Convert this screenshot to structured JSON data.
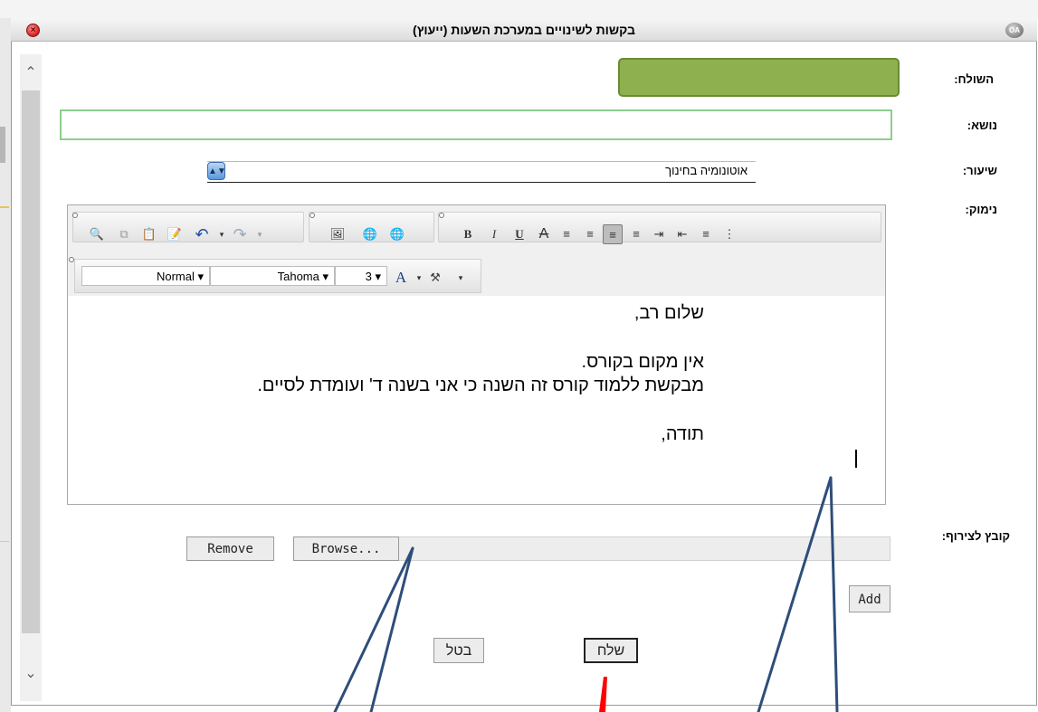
{
  "window": {
    "title": "בקשות לשינויים במערכת השעות (ייעוץ)"
  },
  "form": {
    "sender_label": "השולח:",
    "subject_label": "נושא:",
    "subject_value": "",
    "lesson_label": "שיעור:",
    "lesson_value": "אוטונומיה בחינוך",
    "reason_label": "נימוק:",
    "attach_label": "קובץ לצירוף:"
  },
  "editor": {
    "toolbar": {
      "format": "Normal",
      "font": "Tahoma",
      "size": "3",
      "font_color_glyph": "A"
    },
    "body_lines": [
      "שלום רב,",
      "",
      "אין מקום בקורס.",
      "מבקשת ללמוד קורס זה השנה כי אני בשנה ד' ועומדת לסיים.",
      "",
      "תודה,"
    ]
  },
  "buttons": {
    "remove": "Remove",
    "browse": "Browse...",
    "add": "Add",
    "cancel": "בטל",
    "send": "שלח"
  },
  "colors": {
    "sender_box": "#8fb04e",
    "subject_border": "#8cce8c",
    "annotation_lines": "#2e4e7a",
    "annotation_highlight": "#ff0000"
  },
  "icons": {
    "close": "close-icon",
    "app_logo": "app-logo-icon",
    "scroll_up": "chevron-up-icon",
    "scroll_down": "chevron-down-icon",
    "select_arrows": "select-arrows-icon"
  }
}
